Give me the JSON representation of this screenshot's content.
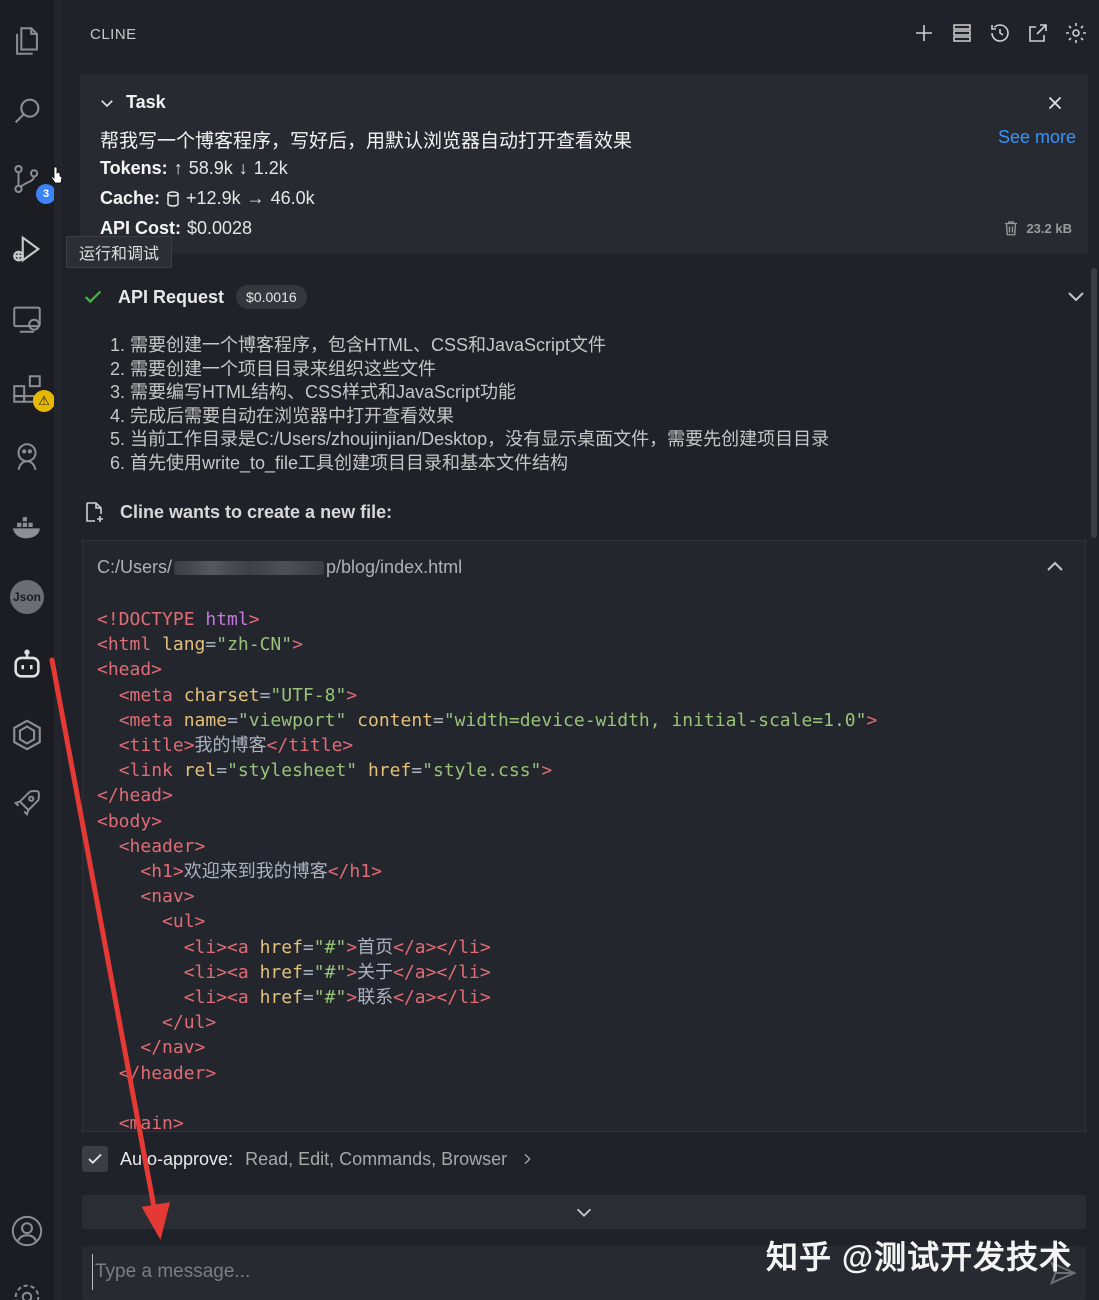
{
  "activity": {
    "tooltip": "运行和调试",
    "scm_badge": "3",
    "json_label": "Json",
    "warn_symbol": "⚠"
  },
  "header": {
    "title": "CLINE"
  },
  "task": {
    "label": "Task",
    "text": "帮我写一个博客程序，写好后，用默认浏览器自动打开查看效果",
    "see_more": "See more",
    "tokens_label": "Tokens:",
    "tokens_up": "58.9k",
    "tokens_down": "1.2k",
    "cache_label": "Cache:",
    "cache_write": "+12.9k",
    "cache_read": "46.0k",
    "cost_label": "API Cost:",
    "cost_value": "$0.0028",
    "size": "23.2 kB"
  },
  "api_request": {
    "label": "API Request",
    "cost": "$0.0016"
  },
  "steps": [
    "1. 需要创建一个博客程序，包含HTML、CSS和JavaScript文件",
    "2. 需要创建一个项目目录来组织这些文件",
    "3. 需要编写HTML结构、CSS样式和JavaScript功能",
    "4. 完成后需要自动在浏览器中打开查看效果",
    "5. 当前工作目录是C:/Users/zhoujinjian/Desktop，没有显示桌面文件，需要先创建项目目录",
    "6. 首先使用write_to_file工具创建项目目录和基本文件结构"
  ],
  "new_file": {
    "label": "Cline wants to create a new file:",
    "path_start": "C:/Users/",
    "path_end": "p/blog/index.html"
  },
  "code_lines": [
    [
      [
        "t",
        "<!DOCTYPE "
      ],
      [
        "k",
        "html"
      ],
      [
        "t",
        ">"
      ]
    ],
    [
      [
        "t",
        "<html "
      ],
      [
        "a",
        "lang"
      ],
      [
        "p",
        "="
      ],
      [
        "s",
        "\"zh-CN\""
      ],
      [
        "t",
        ">"
      ]
    ],
    [
      [
        "t",
        "<head>"
      ]
    ],
    [
      [
        "p",
        "  "
      ],
      [
        "t",
        "<meta "
      ],
      [
        "a",
        "charset"
      ],
      [
        "p",
        "="
      ],
      [
        "s",
        "\"UTF-8\""
      ],
      [
        "t",
        ">"
      ]
    ],
    [
      [
        "p",
        "  "
      ],
      [
        "t",
        "<meta "
      ],
      [
        "a",
        "name"
      ],
      [
        "p",
        "="
      ],
      [
        "s",
        "\"viewport\" "
      ],
      [
        "a",
        "content"
      ],
      [
        "p",
        "="
      ],
      [
        "s",
        "\"width=device-width, initial-scale=1.0\""
      ],
      [
        "t",
        ">"
      ]
    ],
    [
      [
        "p",
        "  "
      ],
      [
        "t",
        "<title>"
      ],
      [
        "p",
        "我的博客"
      ],
      [
        "t",
        "</title>"
      ]
    ],
    [
      [
        "p",
        "  "
      ],
      [
        "t",
        "<link "
      ],
      [
        "a",
        "rel"
      ],
      [
        "p",
        "="
      ],
      [
        "s",
        "\"stylesheet\" "
      ],
      [
        "a",
        "href"
      ],
      [
        "p",
        "="
      ],
      [
        "s",
        "\"style.css\""
      ],
      [
        "t",
        ">"
      ]
    ],
    [
      [
        "t",
        "</head>"
      ]
    ],
    [
      [
        "t",
        "<body>"
      ]
    ],
    [
      [
        "p",
        "  "
      ],
      [
        "t",
        "<header>"
      ]
    ],
    [
      [
        "p",
        "    "
      ],
      [
        "t",
        "<h1>"
      ],
      [
        "p",
        "欢迎来到我的博客"
      ],
      [
        "t",
        "</h1>"
      ]
    ],
    [
      [
        "p",
        "    "
      ],
      [
        "t",
        "<nav>"
      ]
    ],
    [
      [
        "p",
        "      "
      ],
      [
        "t",
        "<ul>"
      ]
    ],
    [
      [
        "p",
        "        "
      ],
      [
        "t",
        "<li><a "
      ],
      [
        "a",
        "href"
      ],
      [
        "p",
        "="
      ],
      [
        "s",
        "\"#\""
      ],
      [
        "t",
        ">"
      ],
      [
        "p",
        "首页"
      ],
      [
        "t",
        "</a></li>"
      ]
    ],
    [
      [
        "p",
        "        "
      ],
      [
        "t",
        "<li><a "
      ],
      [
        "a",
        "href"
      ],
      [
        "p",
        "="
      ],
      [
        "s",
        "\"#\""
      ],
      [
        "t",
        ">"
      ],
      [
        "p",
        "关于"
      ],
      [
        "t",
        "</a></li>"
      ]
    ],
    [
      [
        "p",
        "        "
      ],
      [
        "t",
        "<li><a "
      ],
      [
        "a",
        "href"
      ],
      [
        "p",
        "="
      ],
      [
        "s",
        "\"#\""
      ],
      [
        "t",
        ">"
      ],
      [
        "p",
        "联系"
      ],
      [
        "t",
        "</a></li>"
      ]
    ],
    [
      [
        "p",
        "      "
      ],
      [
        "t",
        "</ul>"
      ]
    ],
    [
      [
        "p",
        "    "
      ],
      [
        "t",
        "</nav>"
      ]
    ],
    [
      [
        "p",
        "  "
      ],
      [
        "t",
        "</header>"
      ]
    ],
    [
      [
        "p",
        ""
      ]
    ],
    [
      [
        "p",
        "  "
      ],
      [
        "t",
        "<main>"
      ]
    ]
  ],
  "auto_approve": {
    "label": "Auto-approve:",
    "values": "Read, Edit, Commands, Browser"
  },
  "input": {
    "placeholder": "Type a message..."
  },
  "watermark": "知乎 @测试开发技术",
  "colors": {
    "background": "#1f2228",
    "accent_link": "#3794ff",
    "success_check": "#4caf50",
    "badge_blue": "#3b83f6",
    "annotation_arrow": "#e53935"
  }
}
